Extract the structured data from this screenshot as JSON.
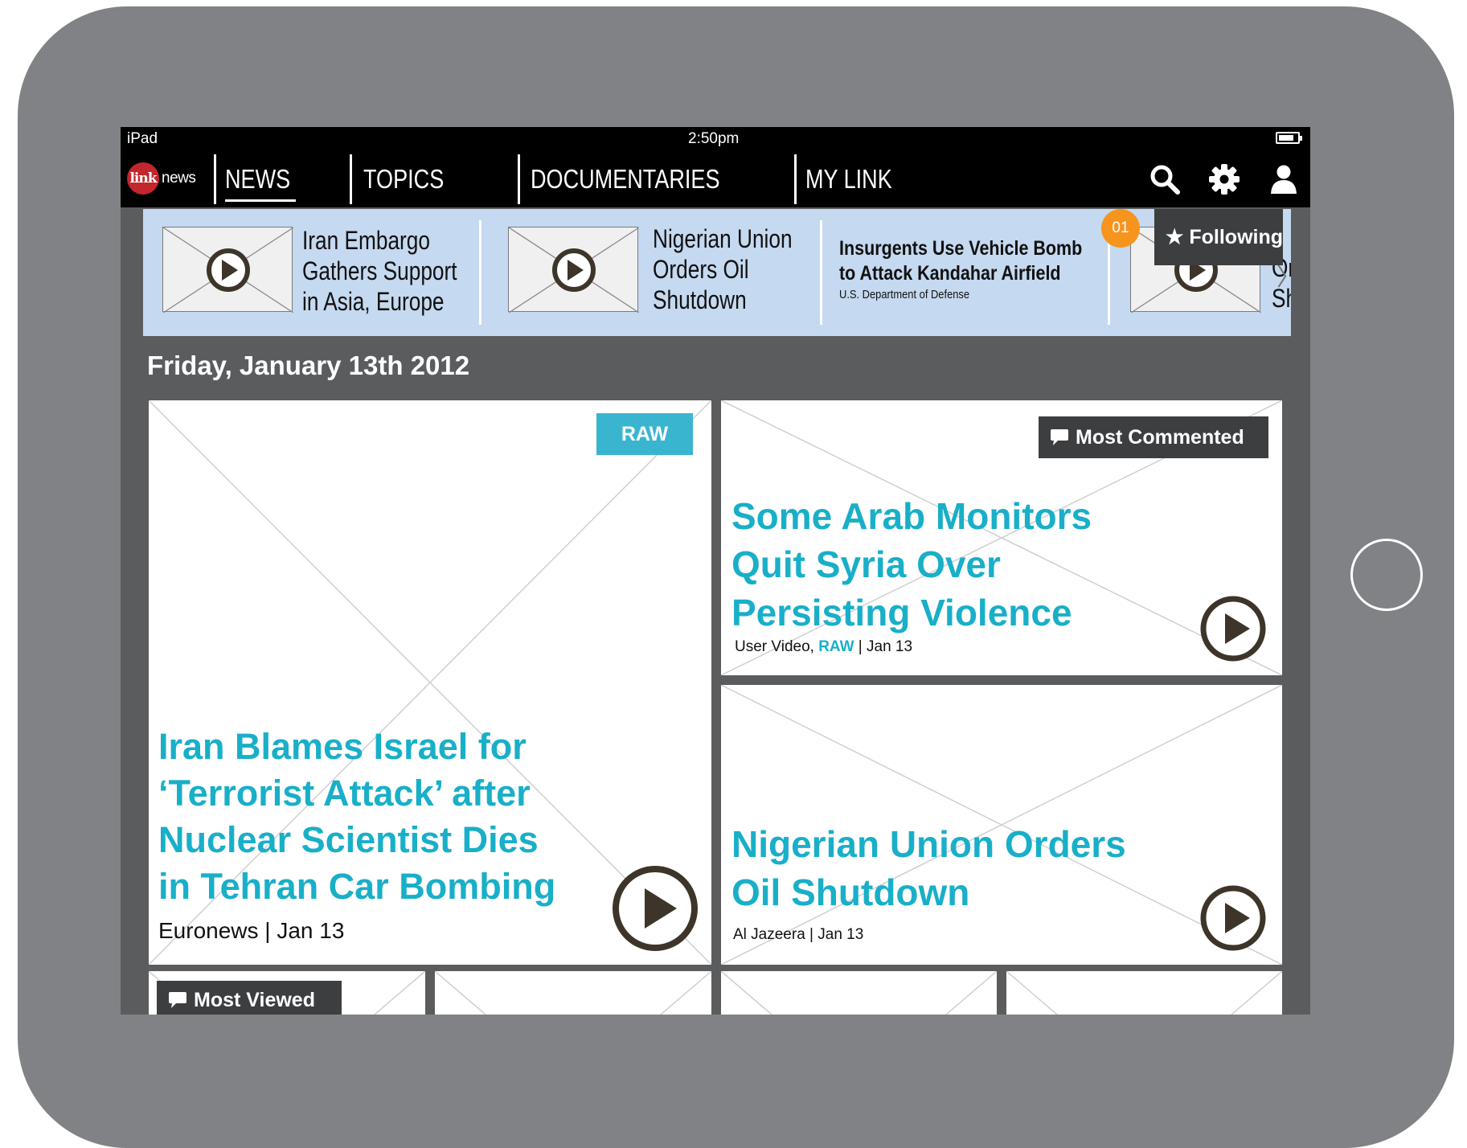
{
  "status_bar": {
    "device": "iPad",
    "time": "2:50pm"
  },
  "nav": {
    "logo_badge": "link",
    "logo_word": "news",
    "items": [
      {
        "label": "NEWS",
        "active": true
      },
      {
        "label": "TOPICS"
      },
      {
        "label": "DOCUMENTARIES"
      },
      {
        "label": "MY LINK"
      }
    ],
    "icons": [
      "search-icon",
      "gear-icon",
      "user-icon"
    ]
  },
  "ticker": {
    "items": [
      {
        "title_lines": [
          "Iran Embargo",
          "Gathers Support",
          "in Asia, Europe"
        ]
      },
      {
        "title_lines": [
          "Nigerian Union",
          "Orders Oil",
          "Shutdown"
        ]
      },
      {
        "title_lines": [
          "Insurgents Use Vehicle Bomb",
          "to Attack Kandahar Airfield"
        ],
        "source": "U.S. Department of Defense"
      },
      {
        "title_lines": [
          "Or",
          "Sh"
        ]
      }
    ],
    "next_arrow": "〉"
  },
  "following": {
    "label": "★ Following",
    "count": "01"
  },
  "date_heading": "Friday, January 13th 2012",
  "cards": {
    "main": {
      "tag": "RAW",
      "headline_lines": [
        "Iran Blames Israel for",
        "‘Terrorist Attack’ after",
        "Nuclear Scientist Dies",
        "in Tehran Car Bombing"
      ],
      "meta": "Euronews | Jan 13"
    },
    "top_right": {
      "tag": "Most Commented",
      "headline_lines": [
        "Some Arab Monitors",
        "Quit Syria Over",
        "Persisting Violence"
      ],
      "meta_prefix": "User Video, ",
      "meta_raw": "RAW",
      "meta_suffix": " | Jan 13"
    },
    "bottom_right": {
      "headline_lines": [
        "Nigerian Union Orders",
        "Oil Shutdown"
      ],
      "meta": "Al Jazeera | Jan 13"
    },
    "small_first": {
      "tag": "Most Viewed"
    }
  },
  "colors": {
    "accent": "#19afc8",
    "raw_tag": "#3ab5d0",
    "badge": "#f7941d",
    "ticker_bg": "#c5d9f0",
    "logo_red": "#c1272d"
  }
}
